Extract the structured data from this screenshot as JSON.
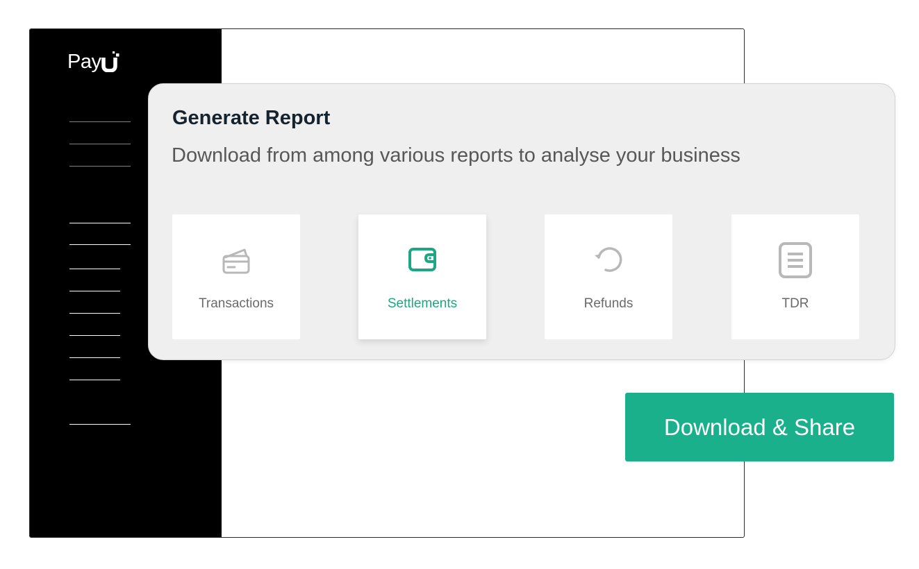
{
  "brand": {
    "name": "PayU",
    "logo_text": "Pay",
    "accent_color": "#19b08b",
    "sidebar_color": "#000000"
  },
  "report": {
    "title": "Generate Report",
    "subtitle": "Download from among various reports to analyse your business",
    "tiles": [
      {
        "label": "Transactions",
        "icon": "credit-card-icon",
        "selected": false
      },
      {
        "label": "Settlements",
        "icon": "wallet-icon",
        "selected": true
      },
      {
        "label": "Refunds",
        "icon": "refresh-arrow-icon",
        "selected": false
      },
      {
        "label": "TDR",
        "icon": "document-lines-icon",
        "selected": false
      }
    ]
  },
  "actions": {
    "download_share_label": "Download & Share"
  }
}
